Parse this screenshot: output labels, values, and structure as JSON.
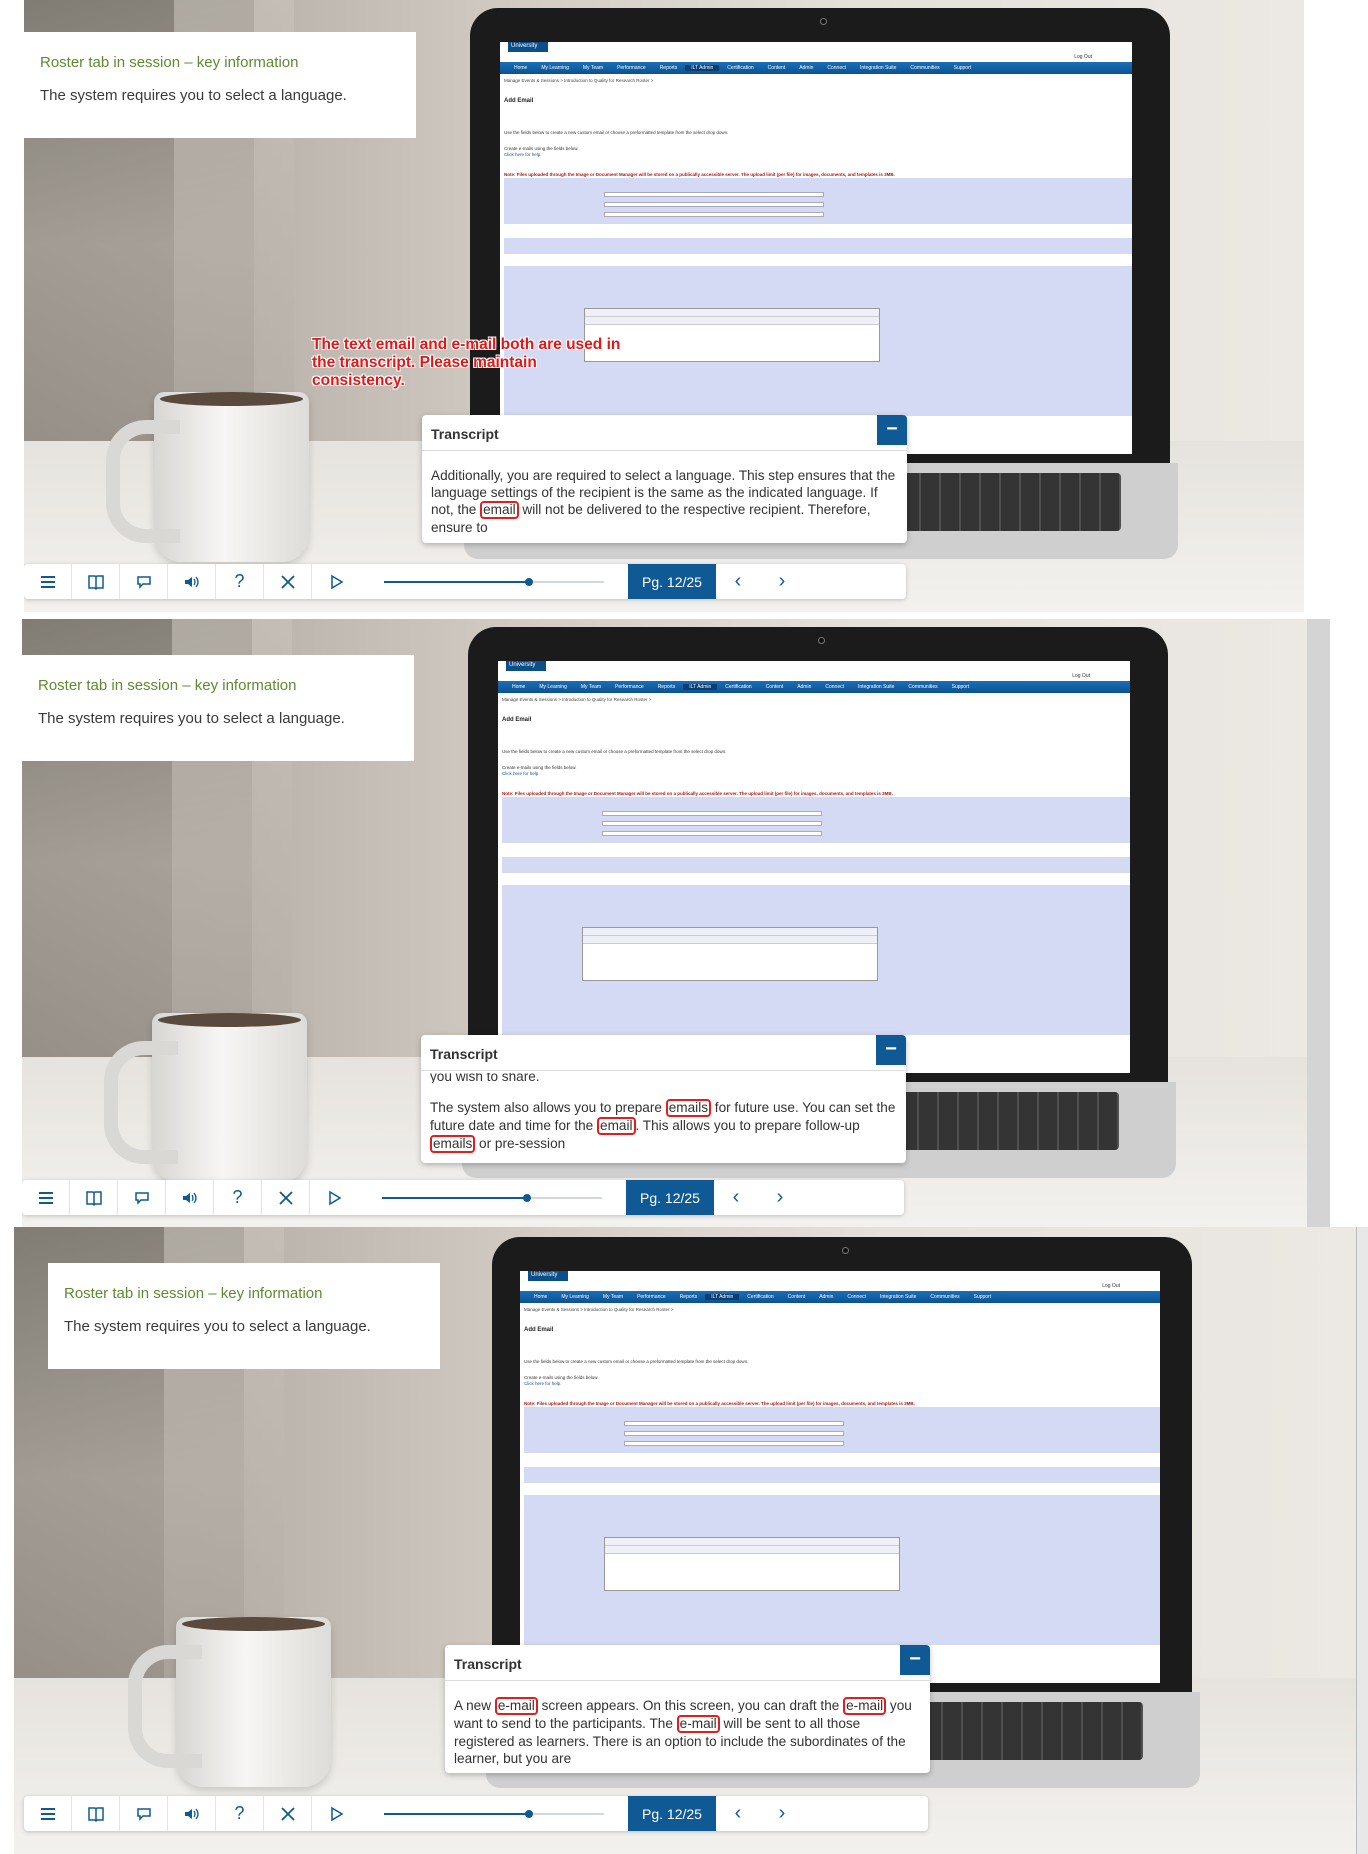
{
  "course": {
    "slide_title": "Roster tab in session – key information",
    "slide_text": "The system requires you to select a language."
  },
  "lms_screen": {
    "logo": "University",
    "logout": "Log Out",
    "nav": [
      "Home",
      "My Learning",
      "My Team",
      "Performance",
      "Reports",
      "ILT Admin",
      "Certification",
      "Content",
      "Admin",
      "Connect",
      "Integration Suite",
      "Communities",
      "Support"
    ],
    "active_nav": "ILT Admin",
    "breadcrumb": "Manage Events & Sessions > Introduction to Quality for Research Roster >",
    "heading": "Add Email",
    "intro": "Use the fields below to create a new custom email or choose a preformatted template from the select drop down.",
    "create_line": "Create e-mails using the fields below.",
    "help_link": "Click here for help.",
    "note": "Note: Files uploaded through the Image or Document Manager will be stored on a publically accessible server. The upload limit (per file) for images, documents, and templates is 3MB."
  },
  "transcript": {
    "header": "Transcript",
    "minimize_icon": "minus-icon",
    "panel1": {
      "before": "Additionally, you are required to select a language. This step ensures that the language settings of the recipient is the same as the indicated language. If not, the ",
      "hl": "email",
      "after": " will not be delivered to the respective recipient. Therefore, ensure to"
    },
    "panel2": {
      "cut": "you wish to share.",
      "p1": "The system also allows you to prepare ",
      "hl1": "emails",
      "p2": " for future use. You can set the future date and time for the ",
      "hl2": "email",
      "p3": ". This allows you to prepare follow-up ",
      "hl3": "emails",
      "p4": " or pre-session"
    },
    "panel3": {
      "p1": "A new ",
      "hl1": "e-mail",
      "p2": " screen appears. On this screen, you can draft the ",
      "hl2": "e-mail",
      "p3": " you want to send to the participants. The ",
      "hl3": "e-mail",
      "p4": " will be sent to all those registered as learners. There is an option to include the subordinates of the learner, but you are"
    }
  },
  "annotation": "The text email and e-mail both are used in the transcript. Please maintain consistency.",
  "player": {
    "page": "Pg. 12/25",
    "progress": 0.66,
    "icons": [
      "menu-icon",
      "book-icon",
      "speech-bubble-icon",
      "volume-icon",
      "help-icon",
      "close-icon",
      "play-icon"
    ],
    "prev_icon": "chevron-left-icon",
    "next_icon": "chevron-right-icon"
  },
  "colors": {
    "accent": "#0f5a94",
    "title_green": "#5e8b2f",
    "annotation_red": "#e01818"
  }
}
